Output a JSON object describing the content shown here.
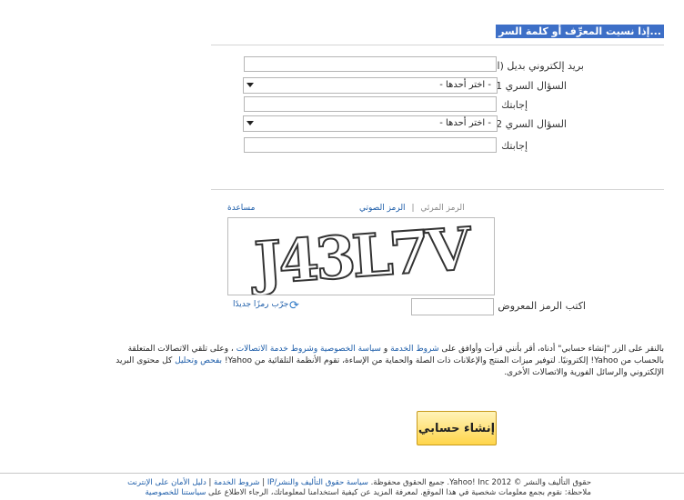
{
  "header": {
    "forgot_link": "إذا نسيت المعرِّف أو كلمة السر..."
  },
  "form": {
    "alt_email_label": "بريد إلكتروني بديل (اختياري)",
    "q1_label": "السؤال السري 1",
    "q1_selected": "- اختر أحدها -",
    "answer1_label": "إجابتك",
    "q2_label": "السؤال السري 2",
    "q2_selected": "- اختر أحدها -",
    "answer2_label": "إجابتك"
  },
  "captcha": {
    "tab_visual": "الرمز المرئي",
    "tab_audio": "الرمز الصوتي",
    "help": "مساعدة",
    "code_text": "J43L7V",
    "refresh_label": "جرّب رمزًا جديدًا",
    "input_label": "اكتب الرمز المعروض"
  },
  "terms": {
    "t1": "بالنقر على الزر \"إنشاء حسابي\" أدناه، أقر بأنني قرأت وأوافق على",
    "l1": "شروط الخدمة",
    "t2": "و",
    "l2": "سياسة الخصوصية",
    "l3": "وشروط خدمة الاتصالات",
    "t3": "، وعلى تلقي الاتصالات المتعلقة بالحساب من Yahoo! إلكترونيًا. لتوفير ميزات المنتج والإعلانات ذات الصلة والحماية من الإساءة، تقوم الأنظمة التلقائية من Yahoo!",
    "l4": "بفحص وتحليل",
    "t4": "كل محتوى البريد الإلكتروني والرسائل الفورية والاتصالات الأخرى."
  },
  "submit_label": "إنشاء حسابي",
  "footer": {
    "copyright": "حقوق التأليف والنشر © 2012 Yahoo! Inc. جميع الحقوق محفوظة.",
    "link_copyright_policy": "سياسة حقوق التأليف والنشر/IP",
    "link_terms": "شروط الخدمة",
    "link_safety": "دليل الأمان على الإنترنت",
    "sep": "|",
    "note": "ملاحظة: نقوم بجمع معلومات شخصية في هذا الموقع. لمعرفة المزيد عن كيفية استخدامنا لمعلوماتك، الرجاء الاطلاع على",
    "link_privacy": "سياستنا للخصوصية"
  }
}
